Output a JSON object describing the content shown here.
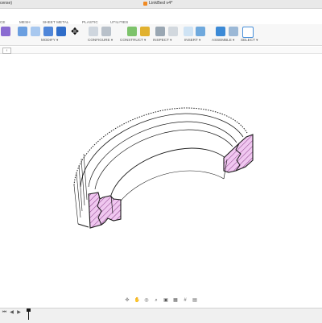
{
  "titlebar": {
    "left_text": "cense)",
    "document_title": "LinkBed v4*"
  },
  "tabs": [
    "CE",
    "MESH",
    "SHEET METAL",
    "PLASTIC",
    "UTILITIES"
  ],
  "groups": [
    "MODIFY ▾",
    "CONFIGURE ▾",
    "CONSTRUCT ▾",
    "INSPECT ▾",
    "INSERT ▾",
    "ASSEMBLE ▾",
    "SELECT ▾"
  ],
  "colors": {
    "accent": "#f08a24",
    "section_fill": "#f0c7f0",
    "hatch": "#7a2c7a",
    "edge": "#1a1a1a"
  },
  "nav_icons": [
    "orbit-icon",
    "pan-icon",
    "look-icon",
    "zoom-icon",
    "fit-icon",
    "display-icon",
    "grid-icon",
    "viewport-icon"
  ],
  "timeline": {
    "controls": [
      "skip-start-icon",
      "step-back-icon",
      "play-icon"
    ]
  }
}
